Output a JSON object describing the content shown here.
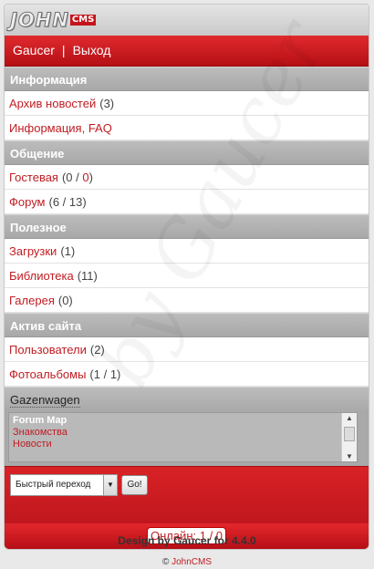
{
  "logo": {
    "main": "JOHN",
    "badge": "CMS"
  },
  "nav": {
    "user": "Gaucer",
    "separator": "|",
    "logout": "Выход"
  },
  "watermark": "by Gaucer",
  "sections": [
    {
      "title": "Информация",
      "items": [
        {
          "label": "Архив новостей",
          "count": "(3)"
        },
        {
          "label": "Информация, FAQ",
          "count": ""
        }
      ]
    },
    {
      "title": "Общение",
      "items": [
        {
          "label": "Гостевая",
          "count_prefix": "(0 / ",
          "count_highlight": "0",
          "count_suffix": ")"
        },
        {
          "label": "Форум",
          "count": "(6 / 13)"
        }
      ]
    },
    {
      "title": "Полезное",
      "items": [
        {
          "label": "Загрузки",
          "count": "(1)"
        },
        {
          "label": "Библиотека",
          "count": "(11)"
        },
        {
          "label": "Галерея",
          "count": "(0)"
        }
      ]
    },
    {
      "title": "Актив сайта",
      "items": [
        {
          "label": "Пользователи",
          "count": "(2)"
        },
        {
          "label": "Фотоальбомы",
          "count": "(1 / 1)"
        }
      ]
    }
  ],
  "gazenwagen": {
    "title": "Gazenwagen",
    "list": [
      "Forum Map",
      "Знакомства",
      "Новости"
    ]
  },
  "quick_jump": {
    "selected": "Быстрый переход",
    "go_label": "Go!"
  },
  "online": "Онлайн: 1 / 0",
  "footer": {
    "design": "Design by Gaucer for 4.4.0",
    "copy_symbol": "©",
    "copy_link": "JohnCMS"
  },
  "colors": {
    "accent": "#c4141b",
    "section_bg": "#b3b3b3",
    "page_bg": "#e9e9e9"
  }
}
